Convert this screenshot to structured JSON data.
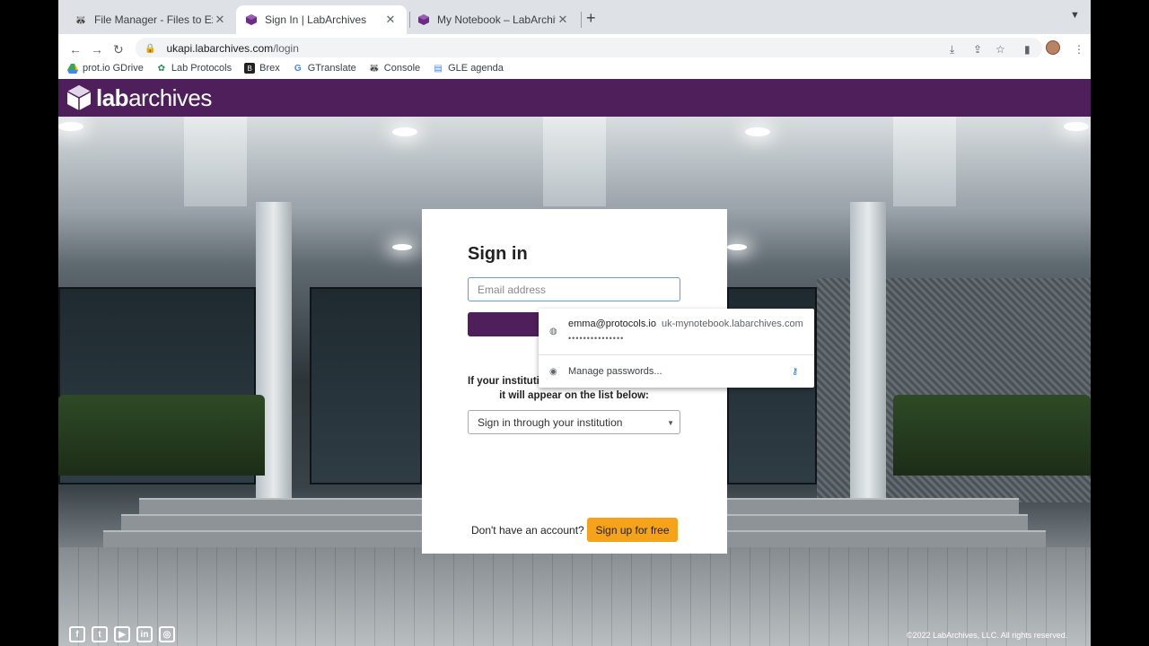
{
  "browser": {
    "tabs": [
      {
        "title": "File Manager - Files to Export",
        "favicon": "raccoon-icon"
      },
      {
        "title": "Sign In | LabArchives",
        "favicon": "labarchives-icon"
      },
      {
        "title": "My Notebook – LabArchives, Y",
        "favicon": "labarchives-icon"
      }
    ],
    "url_host": "ukapi.labarchives.com",
    "url_path": "/login",
    "bookmarks": [
      {
        "label": "prot.io GDrive",
        "icon": "drive-icon"
      },
      {
        "label": "Lab Protocols",
        "icon": "protocols-icon"
      },
      {
        "label": "Brex",
        "icon": "brex-icon"
      },
      {
        "label": "GTranslate",
        "icon": "google-icon"
      },
      {
        "label": "Console",
        "icon": "raccoon-icon"
      },
      {
        "label": "GLE agenda",
        "icon": "doc-icon"
      }
    ]
  },
  "site": {
    "logo_bold": "lab",
    "logo_rest": "archives",
    "brand_color": "#4f1f5c",
    "accent_color": "#f5a31a"
  },
  "signin": {
    "title": "Sign in",
    "email_placeholder": "Email address",
    "institution_line1": "If your institutio",
    "institution_line2": "it will appear on the list below:",
    "institution_select": "Sign in through your institution",
    "no_account": "Don't have an account?",
    "signup_label": "Sign up for free"
  },
  "autofill": {
    "username": "emma@protocols.io",
    "site": "uk-mynotebook.labarchives.com",
    "password_mask": "•••••••••••••••",
    "manage_label": "Manage passwords..."
  },
  "footer": {
    "social": [
      "f",
      "t",
      "▶",
      "in",
      "◎"
    ],
    "copyright": "©2022 LabArchives, LLC. All rights reserved."
  }
}
